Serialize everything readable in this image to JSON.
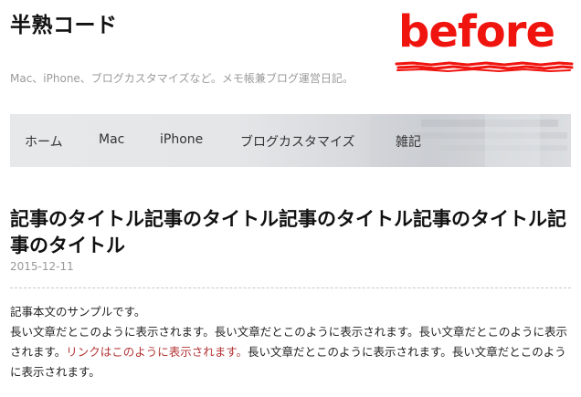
{
  "site": {
    "title": "半熟コード",
    "tagline": "Mac、iPhone、ブログカスタマイズなど。メモ帳兼ブログ運営日記。"
  },
  "overlay": {
    "label": "before",
    "color": "#f0140f"
  },
  "nav": {
    "items": [
      {
        "label": "ホーム"
      },
      {
        "label": "Mac"
      },
      {
        "label": "iPhone"
      },
      {
        "label": "ブログカスタマイズ"
      },
      {
        "label": "雑記"
      }
    ]
  },
  "post": {
    "title": "記事のタイトル記事のタイトル記事のタイトル記事のタイトル記事のタイトル",
    "date": "2015-12-11",
    "body": {
      "line1": "記事本文のサンプルです。",
      "text_before_link": "長い文章だとこのように表示されます。長い文章だとこのように表示されます。長い文章だとこのように表示されます。",
      "link_text": "リンクはこのように表示されます。",
      "text_after_link": "長い文章だとこのように表示されます。長い文章だとこのように表示されます。",
      "link_color": "#b23333"
    }
  }
}
